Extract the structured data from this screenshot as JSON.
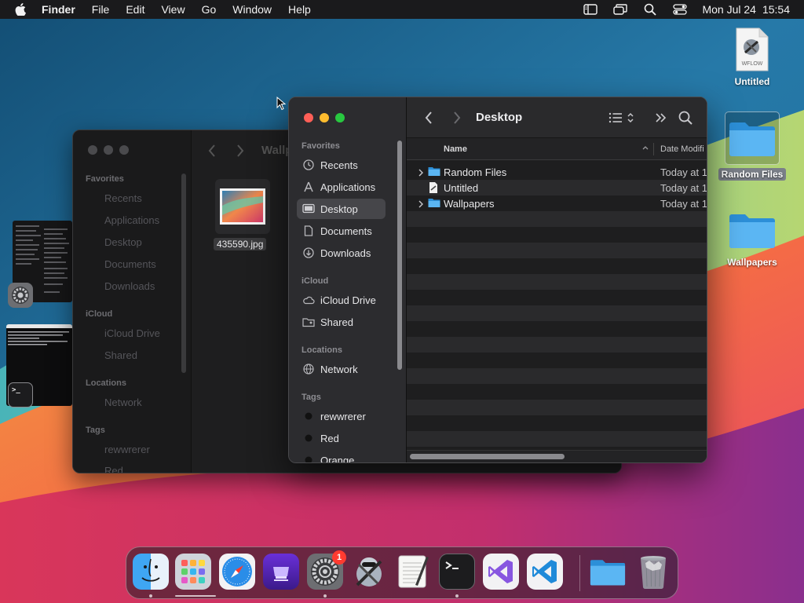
{
  "menubar": {
    "app_name": "Finder",
    "menus": [
      "File",
      "Edit",
      "View",
      "Go",
      "Window",
      "Help"
    ],
    "date": "Mon Jul 24",
    "time": "15:54"
  },
  "desktop": {
    "icons": [
      {
        "label": "Untitled",
        "sublabel": "WFLOW",
        "icon": "workflow-document-icon"
      },
      {
        "label": "Random Files",
        "icon": "folder-icon",
        "selected": true
      },
      {
        "label": "Wallpapers",
        "icon": "folder-icon"
      }
    ]
  },
  "back_window": {
    "title": "Wallp",
    "file_label": "435590.jpg",
    "sidebar": {
      "favorites_heading": "Favorites",
      "favorites": [
        "Recents",
        "Applications",
        "Desktop",
        "Documents",
        "Downloads"
      ],
      "icloud_heading": "iCloud",
      "icloud": [
        "iCloud Drive",
        "Shared"
      ],
      "locations_heading": "Locations",
      "locations": [
        "Network"
      ],
      "tags_heading": "Tags",
      "tags": [
        "rewwrerer",
        "Red"
      ]
    }
  },
  "front_window": {
    "title": "Desktop",
    "sidebar": {
      "favorites_heading": "Favorites",
      "favorites": [
        {
          "label": "Recents",
          "icon": "clock-icon"
        },
        {
          "label": "Applications",
          "icon": "applications-icon"
        },
        {
          "label": "Desktop",
          "icon": "desktop-icon",
          "active": true
        },
        {
          "label": "Documents",
          "icon": "document-icon"
        },
        {
          "label": "Downloads",
          "icon": "download-icon"
        }
      ],
      "icloud_heading": "iCloud",
      "icloud": [
        {
          "label": "iCloud Drive",
          "icon": "cloud-icon"
        },
        {
          "label": "Shared",
          "icon": "shared-folder-icon"
        }
      ],
      "locations_heading": "Locations",
      "locations": [
        {
          "label": "Network",
          "icon": "network-icon"
        }
      ],
      "tags_heading": "Tags",
      "tags": [
        {
          "label": "rewwrerer",
          "color": "#111111"
        },
        {
          "label": "Red",
          "color": "#111111"
        },
        {
          "label": "Orange",
          "color": "#111111"
        }
      ]
    },
    "columns": {
      "name": "Name",
      "date": "Date Modifi"
    },
    "rows": [
      {
        "name": "Random Files",
        "date": "Today at 1",
        "type": "folder",
        "expandable": true
      },
      {
        "name": "Untitled",
        "date": "Today at 1",
        "type": "document",
        "expandable": false
      },
      {
        "name": "Wallpapers",
        "date": "Today at 1",
        "type": "folder",
        "expandable": true
      }
    ]
  },
  "dock": {
    "apps": [
      {
        "name": "Finder",
        "icon": "finder-icon",
        "running": true
      },
      {
        "name": "Launchpad",
        "icon": "launchpad-icon",
        "running": false
      },
      {
        "name": "Safari",
        "icon": "safari-icon",
        "running": false
      },
      {
        "name": "Apple Configurator",
        "icon": "configurator-icon",
        "running": false
      },
      {
        "name": "System Settings",
        "icon": "settings-icon",
        "running": true,
        "badge": "1"
      },
      {
        "name": "Automator",
        "icon": "automator-icon",
        "running": false
      },
      {
        "name": "TextEdit",
        "icon": "textedit-icon",
        "running": false
      },
      {
        "name": "Terminal",
        "icon": "terminal-icon",
        "running": true
      },
      {
        "name": "Visual Studio",
        "icon": "visual-studio-icon",
        "running": false
      },
      {
        "name": "VS Code",
        "icon": "vscode-icon",
        "running": false
      },
      {
        "name": "Downloads Folder",
        "icon": "folder-icon",
        "running": false
      },
      {
        "name": "Trash",
        "icon": "trash-icon",
        "running": false
      }
    ]
  },
  "colors": {
    "accent_blue": "#3fa9f5",
    "close": "#ff5f57",
    "minimize": "#febc2e",
    "zoom": "#28c840",
    "badge": "#ff3b30"
  }
}
